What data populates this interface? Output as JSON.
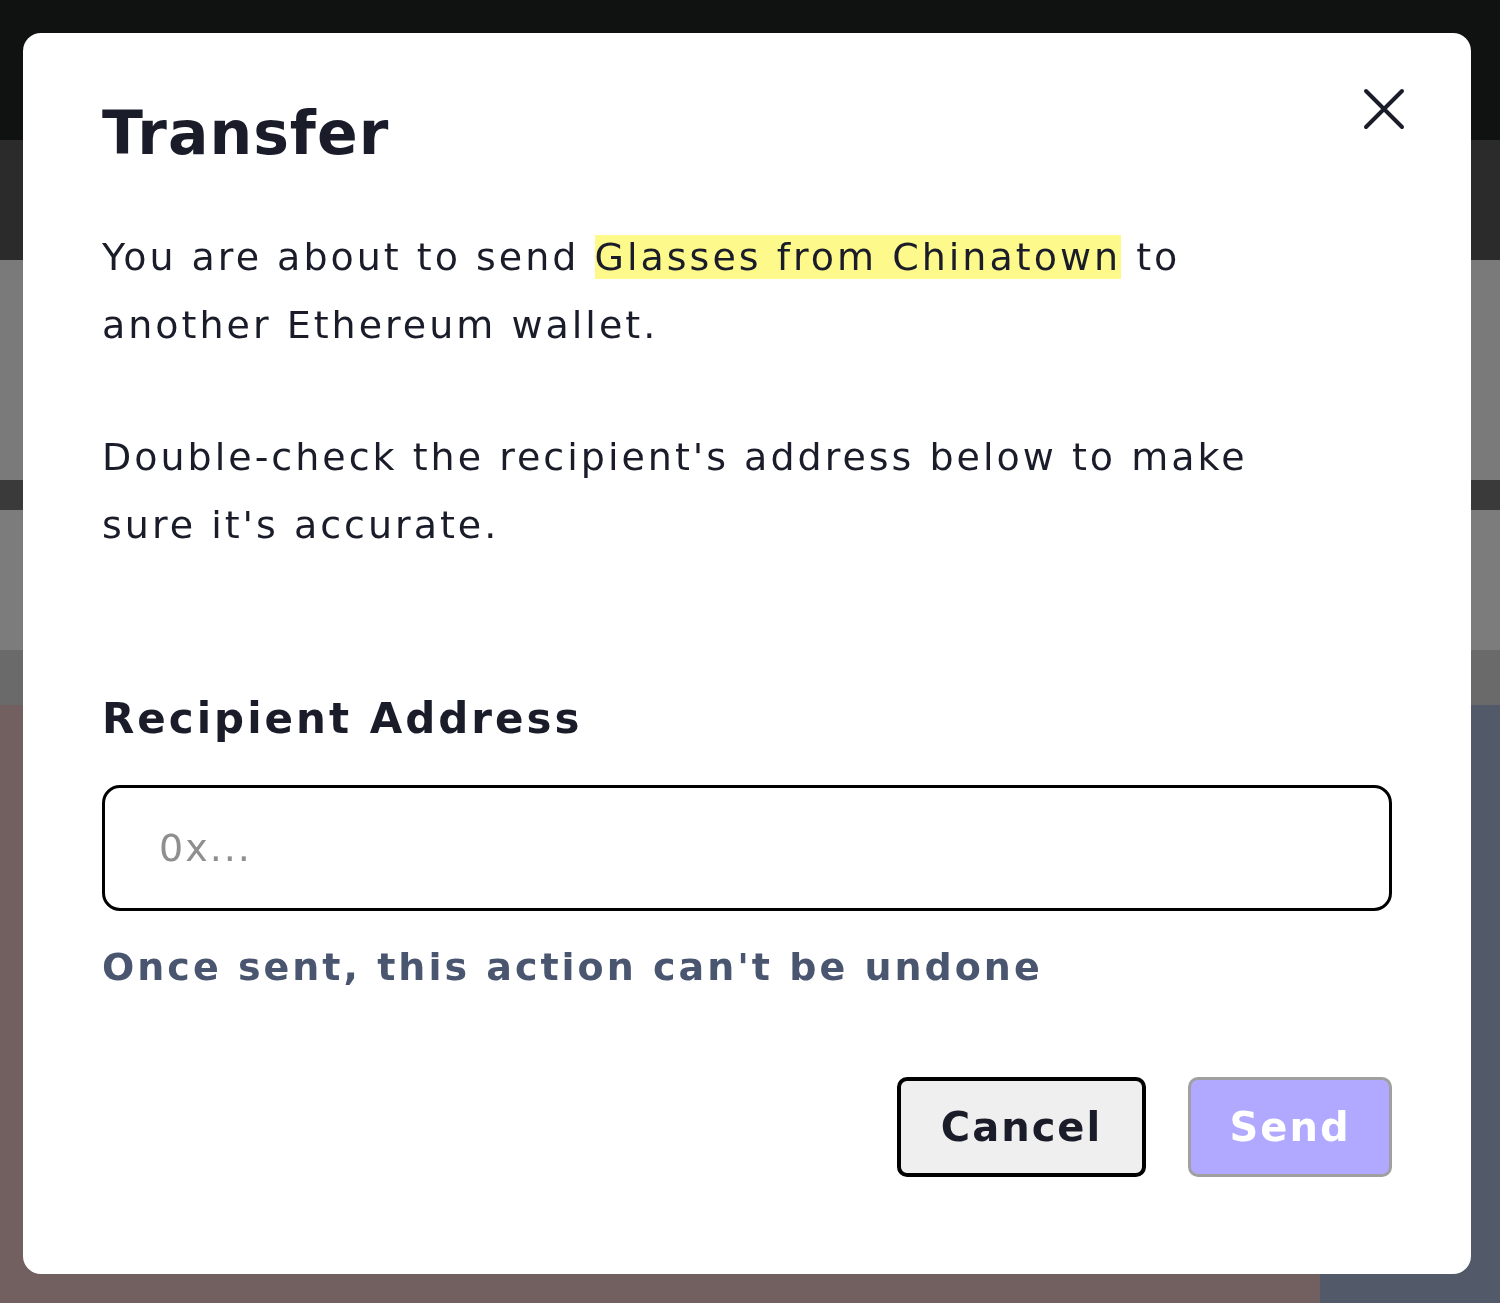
{
  "dialog": {
    "title": "Transfer",
    "message": {
      "before": "You are about to send ",
      "highlight": "Glasses from Chinatown",
      "after": " to another Ethereum wallet."
    },
    "note": "Double-check the recipient's address below to make sure it's accurate.",
    "field": {
      "label": "Recipient Address",
      "placeholder": "0x..."
    },
    "hint": "Once sent, this action can't be undone",
    "buttons": [
      {
        "label": "Cancel",
        "kind": "secondary",
        "disabled": false
      },
      {
        "label": "Send",
        "kind": "primary",
        "disabled": true
      }
    ]
  }
}
